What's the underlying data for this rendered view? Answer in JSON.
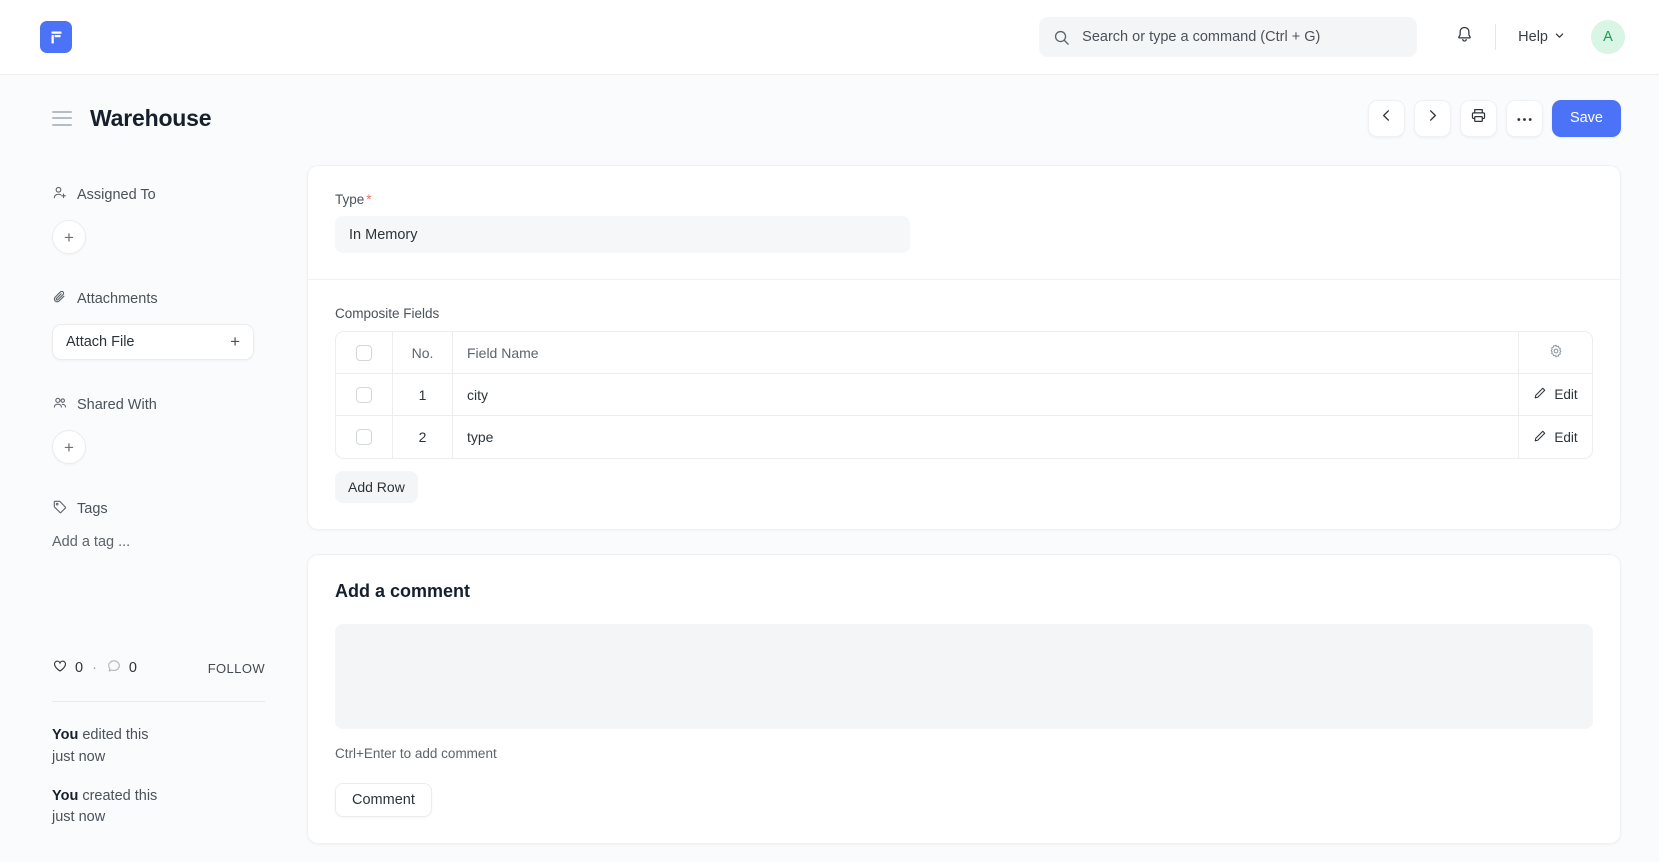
{
  "navbar": {
    "brand_icon": "frappe-logo-icon",
    "search": {
      "icon": "search-icon",
      "placeholder": "Search or type a command (Ctrl + G)",
      "value": ""
    },
    "notifications_icon": "bell-icon",
    "help_label": "Help",
    "help_chevron_icon": "chevron-down-icon",
    "avatar_initial": "A"
  },
  "page_head": {
    "menu_icon": "hamburger-menu-icon",
    "title": "Warehouse",
    "actions": {
      "prev_icon": "chevron-left-icon",
      "next_icon": "chevron-right-icon",
      "print_icon": "printer-icon",
      "more_icon": "ellipsis-icon",
      "save_label": "Save"
    }
  },
  "sidebar": {
    "assigned_to": {
      "icon": "user-plus-icon",
      "label": "Assigned To",
      "add_label": "+"
    },
    "attachments": {
      "icon": "paperclip-icon",
      "label": "Attachments",
      "attach_label": "Attach File",
      "attach_plus": "+"
    },
    "shared_with": {
      "icon": "users-icon",
      "label": "Shared With",
      "add_label": "+"
    },
    "tags": {
      "icon": "tag-icon",
      "label": "Tags",
      "add_tag_label": "Add a tag ..."
    },
    "social": {
      "like_icon": "heart-icon",
      "like_count": "0",
      "separator": "·",
      "comment_icon": "comment-icon",
      "comment_count": "0",
      "follow_label": "FOLLOW"
    },
    "activity": [
      {
        "actor": "You",
        "action": " edited this",
        "time": "just now"
      },
      {
        "actor": "You",
        "action": " created this",
        "time": "just now"
      }
    ]
  },
  "form": {
    "type_field": {
      "label": "Type",
      "required_marker": "*",
      "value": "In Memory"
    },
    "composite_fields": {
      "label": "Composite Fields",
      "settings_icon": "gear-icon",
      "columns": {
        "no": "No.",
        "field_name": "Field Name"
      },
      "rows": [
        {
          "no": "1",
          "field_name": "city",
          "edit_label": "Edit",
          "edit_icon": "pencil-icon"
        },
        {
          "no": "2",
          "field_name": "type",
          "edit_label": "Edit",
          "edit_icon": "pencil-icon"
        }
      ],
      "add_row_label": "Add Row"
    }
  },
  "comment_section": {
    "title": "Add a comment",
    "textarea_value": "",
    "hint": "Ctrl+Enter to add comment",
    "submit_label": "Comment"
  },
  "colors": {
    "brand_blue": "#4b72f7",
    "page_bg": "#fafbfc",
    "required_red": "#f06c6c",
    "avatar_bg": "#d9f5e3",
    "avatar_text": "#1a9c52"
  }
}
